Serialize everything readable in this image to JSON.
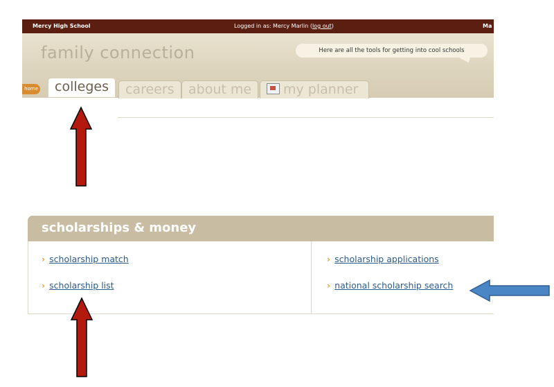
{
  "topbar": {
    "school": "Mercy High School",
    "login_prefix": "Logged in as: Mercy Marlin (",
    "logout": "log out",
    "login_suffix": ")",
    "cut_text": "Ma"
  },
  "header": {
    "logo": "family connection",
    "bubble": "Here are all the tools for getting into cool schools"
  },
  "nav": {
    "home": "home",
    "tabs": [
      "colleges",
      "careers",
      "about me",
      "my planner"
    ]
  },
  "panel": {
    "title": "scholarships & money",
    "left_links": [
      "scholarship match",
      "scholarship list"
    ],
    "right_links": [
      "scholarship applications",
      "national scholarship search"
    ]
  },
  "colors": {
    "bar": "#5b1f12",
    "accent": "#e3a02a",
    "link": "#2c5a8a",
    "arrow_red": "#b31a0d",
    "arrow_blue": "#4a86c5"
  }
}
